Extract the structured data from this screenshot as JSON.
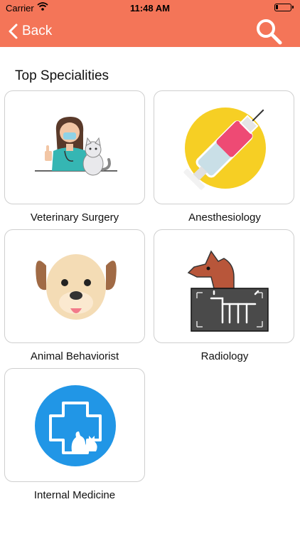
{
  "status_bar": {
    "carrier": "Carrier",
    "time": "11:48 AM"
  },
  "nav": {
    "back_label": "Back"
  },
  "section": {
    "title": "Top Specialities"
  },
  "specialities": [
    {
      "label": "Veterinary Surgery",
      "icon": "veterinarian-with-cat-icon"
    },
    {
      "label": "Anesthesiology",
      "icon": "syringe-icon"
    },
    {
      "label": "Animal Behaviorist",
      "icon": "dog-face-icon"
    },
    {
      "label": "Radiology",
      "icon": "dog-xray-icon"
    },
    {
      "label": "Internal Medicine",
      "icon": "medical-cross-pets-icon"
    }
  ],
  "colors": {
    "header": "#f47558",
    "card_border": "#cfcfcf"
  }
}
